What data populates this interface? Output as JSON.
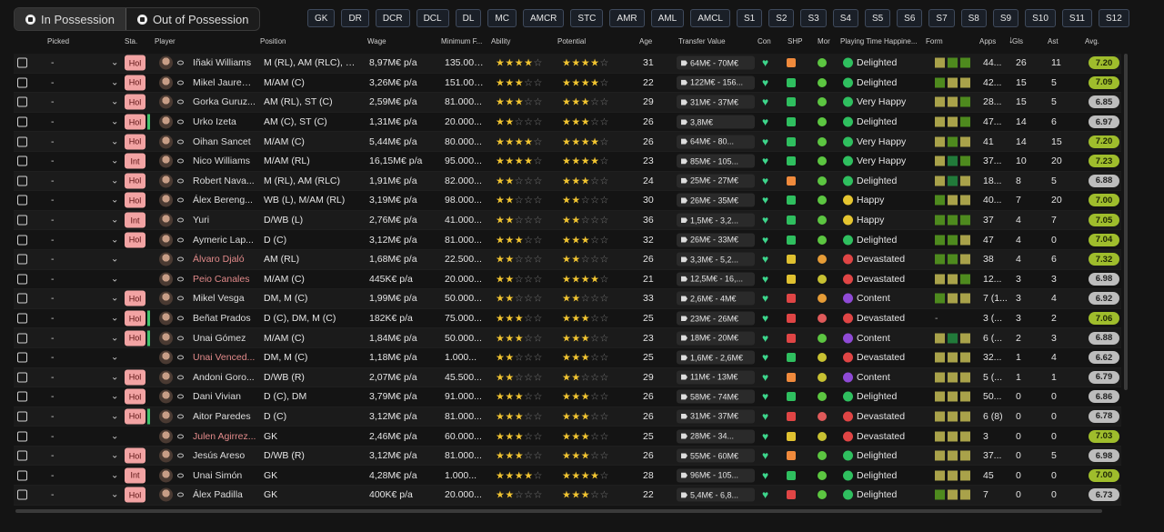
{
  "tabs": [
    {
      "label": "In Possession",
      "active": true
    },
    {
      "label": "Out of Possession",
      "active": false
    }
  ],
  "position_filters": [
    "GK",
    "DR",
    "DCR",
    "DCL",
    "DL",
    "MC",
    "AMCR",
    "STC",
    "AMR",
    "AML",
    "AMCL",
    "S1",
    "S2",
    "S3",
    "S4",
    "S5",
    "S6",
    "S7",
    "S8",
    "S9",
    "S10",
    "S11",
    "S12"
  ],
  "columns": {
    "picked": "Picked",
    "sta": "Sta.",
    "player": "Player",
    "position": "Position",
    "wage": "Wage",
    "min_fee": "Minimum F...",
    "ability": "Ability",
    "potential": "Potential",
    "age": "Age",
    "transfer_value": "Transfer Value",
    "con": "Con",
    "shp": "SHP",
    "mor": "Mor",
    "pt_happiness": "Playing Time Happine...",
    "form": "Form",
    "apps": "Apps",
    "gls": "Gls",
    "ast": "Ast",
    "avg": "Avg."
  },
  "rows": [
    {
      "picked": "-",
      "sta": "Hol",
      "bar": false,
      "name": "Iñaki Williams",
      "name_red": false,
      "position": "M (RL), AM (RLC), S...",
      "wage": "8,97M€ p/a",
      "min_fee": "135.000...",
      "ability": "★★★★☆",
      "potential": "★★★★☆",
      "ab_on": 4,
      "pot_on": 4,
      "age": "31",
      "tv": "64M€ - 70M€",
      "shp": "o",
      "mor": "g",
      "ph": "green",
      "ph_text": "Delighted",
      "form": [
        "f1",
        "f2",
        "f2"
      ],
      "apps": "44...",
      "gls": "26",
      "ast": "11",
      "avg": "7.20",
      "avg_c": "gr"
    },
    {
      "picked": "-",
      "sta": "Hol",
      "bar": false,
      "name": "Mikel Jauregi...",
      "name_red": false,
      "position": "M/AM (C)",
      "wage": "3,26M€ p/a",
      "min_fee": "151.000...",
      "ability": "★★★½☆",
      "potential": "★★★★☆",
      "ab_on": 3,
      "pot_on": 4,
      "age": "22",
      "tv": "122M€ - 156...",
      "shp": "g",
      "mor": "g",
      "ph": "green",
      "ph_text": "Delighted",
      "form": [
        "f2",
        "f1",
        "f1"
      ],
      "apps": "42...",
      "gls": "15",
      "ast": "5",
      "avg": "7.09",
      "avg_c": "gr"
    },
    {
      "picked": "-",
      "sta": "Hol",
      "bar": false,
      "name": "Gorka Guruz...",
      "name_red": false,
      "position": "AM (RL), ST (C)",
      "wage": "2,59M€ p/a",
      "min_fee": "81.000...",
      "ability": "★★★☆☆",
      "potential": "★★★☆☆",
      "ab_on": 3,
      "pot_on": 3,
      "age": "29",
      "tv": "31M€ - 37M€",
      "shp": "g",
      "mor": "g",
      "ph": "green",
      "ph_text": "Very Happy",
      "form": [
        "f1",
        "f1",
        "f2"
      ],
      "apps": "28...",
      "gls": "15",
      "ast": "5",
      "avg": "6.85",
      "avg_c": "gy"
    },
    {
      "picked": "-",
      "sta": "Hol",
      "bar": true,
      "name": "Urko Izeta",
      "name_red": false,
      "position": "AM (C), ST (C)",
      "wage": "1,31M€ p/a",
      "min_fee": "20.000...",
      "ability": "★★½☆☆",
      "potential": "★★★☆☆",
      "ab_on": 2,
      "pot_on": 3,
      "age": "26",
      "tv": "3,8M€",
      "shp": "g",
      "mor": "g",
      "ph": "green",
      "ph_text": "Delighted",
      "form": [
        "f1",
        "f1",
        "f2"
      ],
      "apps": "47...",
      "gls": "14",
      "ast": "6",
      "avg": "6.97",
      "avg_c": "gy"
    },
    {
      "picked": "-",
      "sta": "Hol",
      "bar": false,
      "name": "Oihan Sancet",
      "name_red": false,
      "position": "M/AM (C)",
      "wage": "5,44M€ p/a",
      "min_fee": "80.000...",
      "ability": "★★★★☆",
      "potential": "★★★★☆",
      "ab_on": 4,
      "pot_on": 4,
      "age": "26",
      "tv": "64M€ - 80...",
      "shp": "g",
      "mor": "g",
      "ph": "green",
      "ph_text": "Very Happy",
      "form": [
        "f1",
        "f2",
        "f1"
      ],
      "apps": "41",
      "gls": "14",
      "ast": "15",
      "avg": "7.20",
      "avg_c": "gr"
    },
    {
      "picked": "-",
      "sta": "Int",
      "bar": false,
      "name": "Nico Williams",
      "name_red": false,
      "position": "M/AM (RL)",
      "wage": "16,15M€ p/a",
      "min_fee": "95.000...",
      "ability": "★★★★½",
      "potential": "★★★★½",
      "ab_on": 4,
      "pot_on": 4,
      "age": "23",
      "tv": "85M€ - 105...",
      "shp": "g",
      "mor": "g",
      "ph": "green",
      "ph_text": "Very Happy",
      "form": [
        "f1",
        "f3",
        "f2"
      ],
      "apps": "37...",
      "gls": "10",
      "ast": "20",
      "avg": "7.23",
      "avg_c": "gr"
    },
    {
      "picked": "-",
      "sta": "Hol",
      "bar": false,
      "name": "Robert Nava...",
      "name_red": false,
      "position": "M (RL), AM (RLC)",
      "wage": "1,91M€ p/a",
      "min_fee": "82.000...",
      "ability": "★★½☆☆",
      "potential": "★★★☆☆",
      "ab_on": 2,
      "pot_on": 3,
      "age": "24",
      "tv": "25M€ - 27M€",
      "shp": "o",
      "mor": "g",
      "ph": "green",
      "ph_text": "Delighted",
      "form": [
        "f1",
        "f3",
        "f1"
      ],
      "apps": "18...",
      "gls": "8",
      "ast": "5",
      "avg": "6.88",
      "avg_c": "gy"
    },
    {
      "picked": "-",
      "sta": "Hol",
      "bar": false,
      "name": "Álex Bereng...",
      "name_red": false,
      "position": "WB (L), M/AM (RL)",
      "wage": "3,19M€ p/a",
      "min_fee": "98.000...",
      "ability": "★★½☆☆",
      "potential": "★★½☆☆",
      "ab_on": 2,
      "pot_on": 2,
      "age": "30",
      "tv": "26M€ - 35M€",
      "shp": "g",
      "mor": "g",
      "ph": "yellow",
      "ph_text": "Happy",
      "form": [
        "f2",
        "f1",
        "f1"
      ],
      "apps": "40...",
      "gls": "7",
      "ast": "20",
      "avg": "7.00",
      "avg_c": "gr"
    },
    {
      "picked": "-",
      "sta": "Int",
      "bar": false,
      "name": "Yuri",
      "name_red": false,
      "position": "D/WB (L)",
      "wage": "2,76M€ p/a",
      "min_fee": "41.000...",
      "ability": "★★½☆☆",
      "potential": "★★½☆☆",
      "ab_on": 2,
      "pot_on": 2,
      "age": "36",
      "tv": "1,5M€ - 3,2...",
      "shp": "g",
      "mor": "g",
      "ph": "yellow",
      "ph_text": "Happy",
      "form": [
        "f2",
        "f2",
        "f2"
      ],
      "apps": "37",
      "gls": "4",
      "ast": "7",
      "avg": "7.05",
      "avg_c": "gr"
    },
    {
      "picked": "-",
      "sta": "Hol",
      "bar": false,
      "name": "Aymeric Lap...",
      "name_red": false,
      "position": "D (C)",
      "wage": "3,12M€ p/a",
      "min_fee": "81.000...",
      "ability": "★★★☆☆",
      "potential": "★★★☆☆",
      "ab_on": 3,
      "pot_on": 3,
      "age": "32",
      "tv": "26M€ - 33M€",
      "shp": "g",
      "mor": "g",
      "ph": "green",
      "ph_text": "Delighted",
      "form": [
        "f2",
        "f2",
        "f1"
      ],
      "apps": "47",
      "gls": "4",
      "ast": "0",
      "avg": "7.04",
      "avg_c": "gr"
    },
    {
      "picked": "-",
      "sta": "",
      "bar": false,
      "name": "Álvaro Djaló",
      "name_red": true,
      "position": "AM (RL)",
      "wage": "1,68M€ p/a",
      "min_fee": "22.500...",
      "ability": "★★½☆☆",
      "potential": "★★½☆☆",
      "ab_on": 2,
      "pot_on": 2,
      "age": "26",
      "tv": "3,3M€ - 5,2...",
      "shp": "y",
      "mor": "o",
      "ph": "red",
      "ph_text": "Devastated",
      "form": [
        "f2",
        "f2",
        "f1"
      ],
      "apps": "38",
      "gls": "4",
      "ast": "6",
      "avg": "7.32",
      "avg_c": "gr"
    },
    {
      "picked": "-",
      "sta": "",
      "bar": false,
      "name": "Peio Canales",
      "name_red": true,
      "position": "M/AM (C)",
      "wage": "445K€ p/a",
      "min_fee": "20.000...",
      "ability": "★★½☆☆",
      "potential": "★★★★☆",
      "ab_on": 2,
      "pot_on": 4,
      "age": "21",
      "tv": "12,5M€ - 16,...",
      "shp": "y",
      "mor": "y",
      "ph": "red",
      "ph_text": "Devastated",
      "form": [
        "f1",
        "f1",
        "f2"
      ],
      "apps": "12...",
      "gls": "3",
      "ast": "3",
      "avg": "6.98",
      "avg_c": "gy"
    },
    {
      "picked": "-",
      "sta": "Hol",
      "bar": false,
      "name": "Mikel Vesga",
      "name_red": false,
      "position": "DM, M (C)",
      "wage": "1,99M€ p/a",
      "min_fee": "50.000...",
      "ability": "★★½☆☆",
      "potential": "★★½☆☆",
      "ab_on": 2,
      "pot_on": 2,
      "age": "33",
      "tv": "2,6M€ - 4M€",
      "shp": "r",
      "mor": "o",
      "ph": "purple",
      "ph_text": "Content",
      "form": [
        "f2",
        "f1",
        "f1"
      ],
      "apps": "7 (1...",
      "gls": "3",
      "ast": "4",
      "avg": "6.92",
      "avg_c": "gy"
    },
    {
      "picked": "-",
      "sta": "Hol",
      "bar": true,
      "name": "Beñat Prados",
      "name_red": false,
      "position": "D (C), DM, M (C)",
      "wage": "182K€ p/a",
      "min_fee": "75.000...",
      "ability": "★★★☆☆",
      "potential": "★★★☆☆",
      "ab_on": 3,
      "pot_on": 3,
      "age": "25",
      "tv": "23M€ - 26M€",
      "shp": "r",
      "mor": "r",
      "ph": "red",
      "ph_text": "Devastated",
      "form": [],
      "apps": "3 (...",
      "gls": "3",
      "ast": "2",
      "avg": "7.06",
      "avg_c": "gr"
    },
    {
      "picked": "-",
      "sta": "Hol",
      "bar": true,
      "name": "Unai Gómez",
      "name_red": false,
      "position": "M/AM (C)",
      "wage": "1,84M€ p/a",
      "min_fee": "50.000...",
      "ability": "★★★☆☆",
      "potential": "★★★☆☆",
      "ab_on": 3,
      "pot_on": 3,
      "age": "23",
      "tv": "18M€ - 20M€",
      "shp": "r",
      "mor": "g",
      "ph": "purple",
      "ph_text": "Content",
      "form": [
        "f1",
        "f3",
        "f1"
      ],
      "apps": "6 (...",
      "gls": "2",
      "ast": "3",
      "avg": "6.88",
      "avg_c": "gy"
    },
    {
      "picked": "-",
      "sta": "",
      "bar": false,
      "name": "Unai Venced...",
      "name_red": true,
      "position": "DM, M (C)",
      "wage": "1,18M€ p/a",
      "min_fee": "1.000...",
      "ability": "★★½☆☆",
      "potential": "★★★☆☆",
      "ab_on": 2,
      "pot_on": 3,
      "age": "25",
      "tv": "1,6M€ - 2,6M€",
      "shp": "g",
      "mor": "y",
      "ph": "red",
      "ph_text": "Devastated",
      "form": [
        "f1",
        "f1",
        "f1"
      ],
      "apps": "32...",
      "gls": "1",
      "ast": "4",
      "avg": "6.62",
      "avg_c": "gy"
    },
    {
      "picked": "-",
      "sta": "Hol",
      "bar": false,
      "name": "Andoni Goro...",
      "name_red": false,
      "position": "D/WB (R)",
      "wage": "2,07M€ p/a",
      "min_fee": "45.500...",
      "ability": "★★½☆☆",
      "potential": "★★½☆☆",
      "ab_on": 2,
      "pot_on": 2,
      "age": "29",
      "tv": "11M€ - 13M€",
      "shp": "o",
      "mor": "y",
      "ph": "purple",
      "ph_text": "Content",
      "form": [
        "f1",
        "f1",
        "f1"
      ],
      "apps": "5 (...",
      "gls": "1",
      "ast": "1",
      "avg": "6.79",
      "avg_c": "gy"
    },
    {
      "picked": "-",
      "sta": "Hol",
      "bar": false,
      "name": "Dani Vivian",
      "name_red": false,
      "position": "D (C), DM",
      "wage": "3,79M€ p/a",
      "min_fee": "91.000...",
      "ability": "★★★☆☆",
      "potential": "★★★☆☆",
      "ab_on": 3,
      "pot_on": 3,
      "age": "26",
      "tv": "58M€ - 74M€",
      "shp": "g",
      "mor": "g",
      "ph": "green",
      "ph_text": "Delighted",
      "form": [
        "f1",
        "f1",
        "f1"
      ],
      "apps": "50...",
      "gls": "0",
      "ast": "0",
      "avg": "6.86",
      "avg_c": "gy"
    },
    {
      "picked": "-",
      "sta": "Hol",
      "bar": true,
      "name": "Aitor Paredes",
      "name_red": false,
      "position": "D (C)",
      "wage": "3,12M€ p/a",
      "min_fee": "81.000...",
      "ability": "★★★☆☆",
      "potential": "★★★☆☆",
      "ab_on": 3,
      "pot_on": 3,
      "age": "26",
      "tv": "31M€ - 37M€",
      "shp": "r",
      "mor": "r",
      "ph": "red",
      "ph_text": "Devastated",
      "form": [
        "f1",
        "f1",
        "f1"
      ],
      "apps": "6 (8)",
      "gls": "0",
      "ast": "0",
      "avg": "6.78",
      "avg_c": "gy"
    },
    {
      "picked": "-",
      "sta": "",
      "bar": false,
      "name": "Julen Agirrez...",
      "name_red": true,
      "position": "GK",
      "wage": "2,46M€ p/a",
      "min_fee": "60.000...",
      "ability": "★★★☆☆",
      "potential": "★★★☆☆",
      "ab_on": 3,
      "pot_on": 3,
      "age": "25",
      "tv": "28M€ - 34...",
      "shp": "y",
      "mor": "y",
      "ph": "red",
      "ph_text": "Devastated",
      "form": [
        "f1",
        "f1",
        "f1"
      ],
      "apps": "3",
      "gls": "0",
      "ast": "0",
      "avg": "7.03",
      "avg_c": "gr"
    },
    {
      "picked": "-",
      "sta": "Hol",
      "bar": false,
      "name": "Jesús Areso",
      "name_red": false,
      "position": "D/WB (R)",
      "wage": "3,12M€ p/a",
      "min_fee": "81.000...",
      "ability": "★★★☆☆",
      "potential": "★★★☆☆",
      "ab_on": 3,
      "pot_on": 3,
      "age": "26",
      "tv": "55M€ - 60M€",
      "shp": "o",
      "mor": "g",
      "ph": "green",
      "ph_text": "Delighted",
      "form": [
        "f1",
        "f1",
        "f1"
      ],
      "apps": "37...",
      "gls": "0",
      "ast": "5",
      "avg": "6.98",
      "avg_c": "gy"
    },
    {
      "picked": "-",
      "sta": "Int",
      "bar": false,
      "name": "Unai Simón",
      "name_red": false,
      "position": "GK",
      "wage": "4,28M€ p/a",
      "min_fee": "1.000...",
      "ability": "★★★★☆",
      "potential": "★★★★☆",
      "ab_on": 4,
      "pot_on": 4,
      "age": "28",
      "tv": "96M€ - 105...",
      "shp": "g",
      "mor": "g",
      "ph": "green",
      "ph_text": "Delighted",
      "form": [
        "f1",
        "f1",
        "f1"
      ],
      "apps": "45",
      "gls": "0",
      "ast": "0",
      "avg": "7.00",
      "avg_c": "gr"
    },
    {
      "picked": "-",
      "sta": "Hol",
      "bar": false,
      "name": "Álex Padilla",
      "name_red": false,
      "position": "GK",
      "wage": "400K€ p/a",
      "min_fee": "20.000...",
      "ability": "★★½☆☆",
      "potential": "★★★☆☆",
      "ab_on": 2,
      "pot_on": 3,
      "age": "22",
      "tv": "5,4M€ - 6,8...",
      "shp": "r",
      "mor": "g",
      "ph": "green",
      "ph_text": "Delighted",
      "form": [
        "f2",
        "f1",
        "f1"
      ],
      "apps": "7",
      "gls": "0",
      "ast": "0",
      "avg": "6.73",
      "avg_c": "gy"
    }
  ]
}
